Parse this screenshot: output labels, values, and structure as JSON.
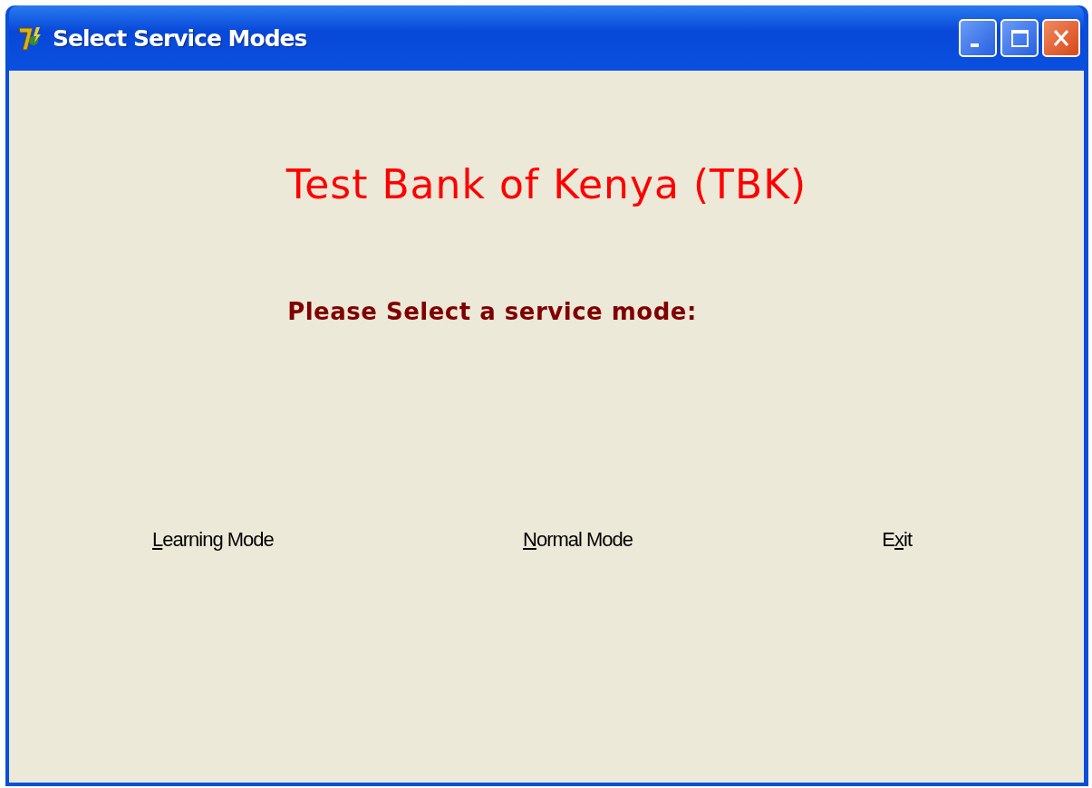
{
  "window": {
    "title": "Select Service Modes"
  },
  "heading": "Test Bank of Kenya (TBK)",
  "prompt": "Please Select a service mode:",
  "buttons": [
    {
      "key": "L",
      "post": "earning Mode"
    },
    {
      "key": "N",
      "post": "ormal Mode"
    },
    {
      "pre": "E",
      "key": "x",
      "post": "it"
    }
  ]
}
